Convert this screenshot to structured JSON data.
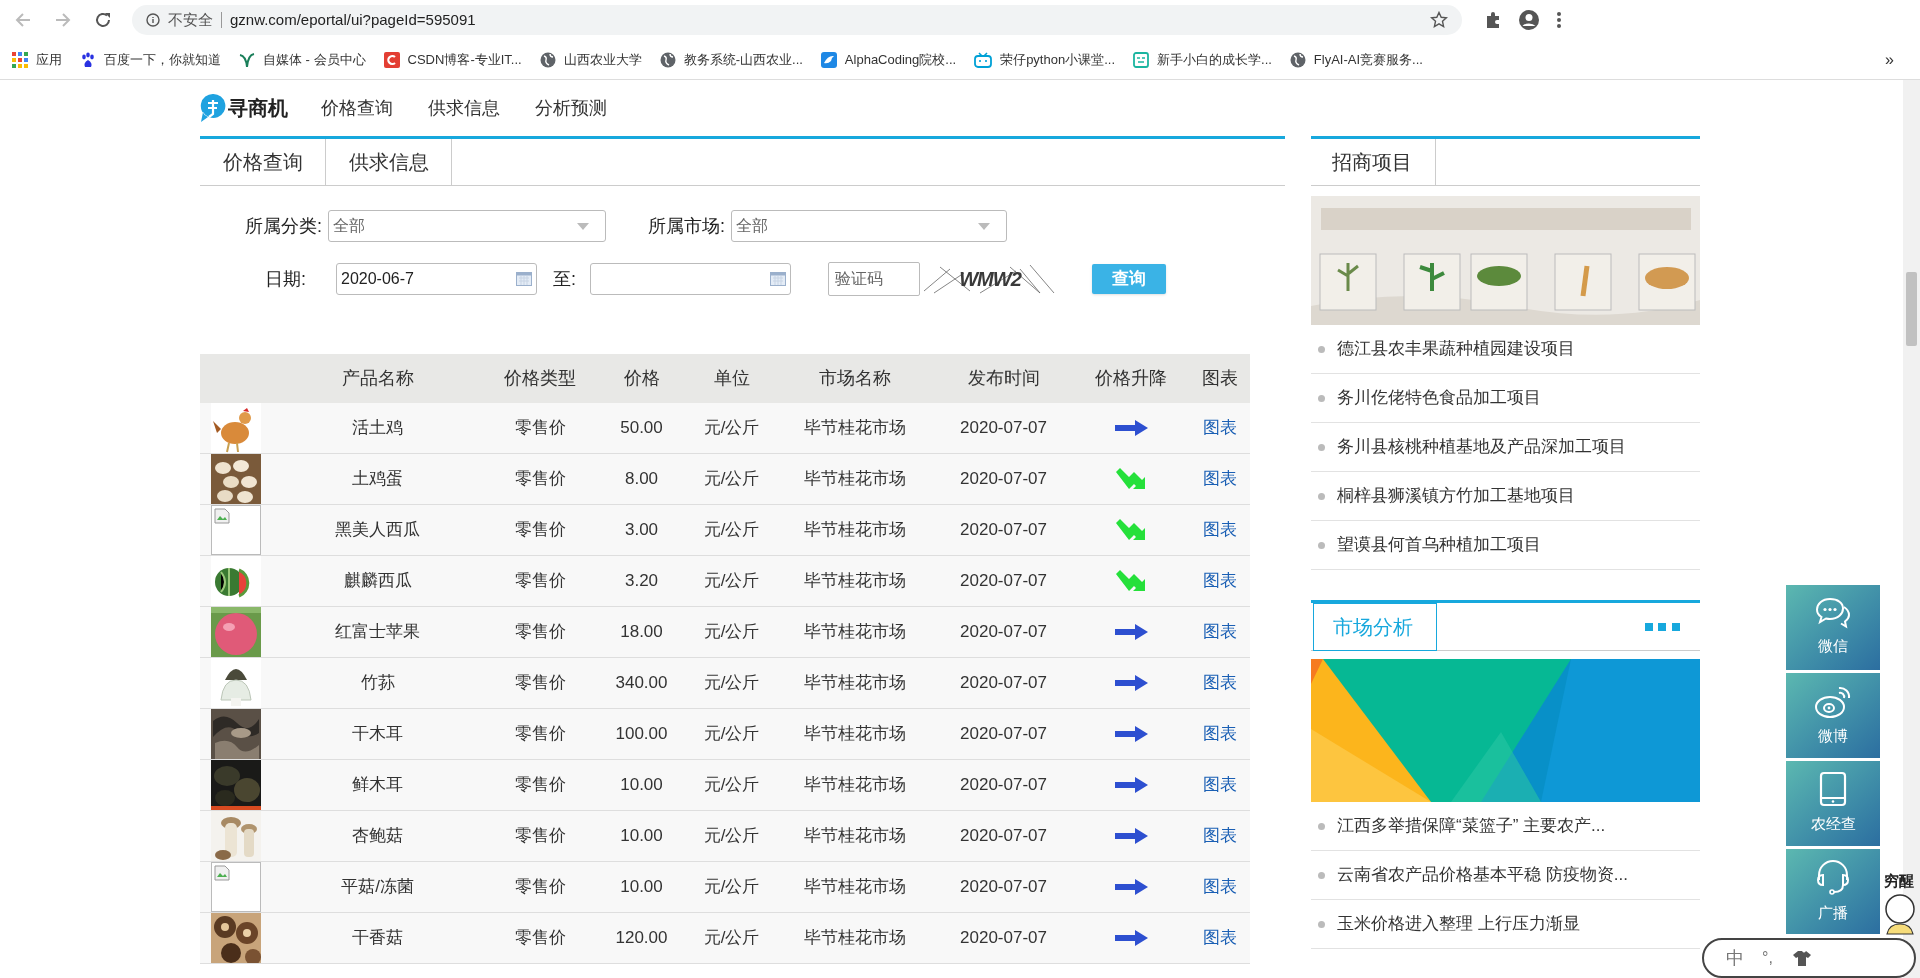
{
  "browser": {
    "security": "不安全",
    "url": "gznw.com/eportal/ui?pageId=595091",
    "bookmarks": [
      "应用",
      "百度一下，你就知道",
      "自媒体 - 会员中心",
      "CSDN博客-专业IT...",
      "山西农业大学",
      "教务系统-山西农业...",
      "AlphaCoding院校...",
      "荣仔python小课堂...",
      "新手小白的成长学...",
      "FlyAI-AI竞赛服务..."
    ],
    "more": "»"
  },
  "site": {
    "logo": "寻商机",
    "nav": [
      "价格查询",
      "供求信息",
      "分析预测"
    ]
  },
  "tabs": [
    "价格查询",
    "供求信息"
  ],
  "filters": {
    "category_label": "所属分类:",
    "category_value": "全部",
    "market_label": "所属市场:",
    "market_value": "全部",
    "date_label": "日期:",
    "date_from": "2020-06-7",
    "to_label": "至:",
    "captcha_placeholder": "验证码",
    "captcha_code": "WMW2",
    "submit": "查询"
  },
  "table": {
    "columns": [
      "产品名称",
      "价格类型",
      "价格",
      "单位",
      "市场名称",
      "发布时间",
      "价格升降",
      "图表"
    ],
    "rows": [
      {
        "name": "活土鸡",
        "price_type": "零售价",
        "price": "50.00",
        "unit": "元/公斤",
        "market": "毕节桂花市场",
        "date": "2020-07-07",
        "trend": {
          "kind": "flat"
        },
        "chart": "图表"
      },
      {
        "name": "土鸡蛋",
        "price_type": "零售价",
        "price": "8.00",
        "unit": "元/公斤",
        "market": "毕节桂花市场",
        "date": "2020-07-07",
        "trend": {
          "kind": "down"
        },
        "chart": "图表"
      },
      {
        "image": {
          "kind": "broken"
        },
        "name": "黑美人西瓜",
        "price_type": "零售价",
        "price": "3.00",
        "unit": "元/公斤",
        "market": "毕节桂花市场",
        "date": "2020-07-07",
        "trend": {
          "kind": "down"
        },
        "chart": "图表"
      },
      {
        "name": "麒麟西瓜",
        "price_type": "零售价",
        "price": "3.20",
        "unit": "元/公斤",
        "market": "毕节桂花市场",
        "date": "2020-07-07",
        "trend": {
          "kind": "down"
        },
        "chart": "图表"
      },
      {
        "name": "红富士苹果",
        "price_type": "零售价",
        "price": "18.00",
        "unit": "元/公斤",
        "market": "毕节桂花市场",
        "date": "2020-07-07",
        "trend": {
          "kind": "flat"
        },
        "chart": "图表"
      },
      {
        "name": "竹荪",
        "price_type": "零售价",
        "price": "340.00",
        "unit": "元/公斤",
        "market": "毕节桂花市场",
        "date": "2020-07-07",
        "trend": {
          "kind": "flat"
        },
        "chart": "图表"
      },
      {
        "name": "干木耳",
        "price_type": "零售价",
        "price": "100.00",
        "unit": "元/公斤",
        "market": "毕节桂花市场",
        "date": "2020-07-07",
        "trend": {
          "kind": "flat"
        },
        "chart": "图表"
      },
      {
        "name": "鲜木耳",
        "price_type": "零售价",
        "price": "10.00",
        "unit": "元/公斤",
        "market": "毕节桂花市场",
        "date": "2020-07-07",
        "trend": {
          "kind": "flat"
        },
        "chart": "图表"
      },
      {
        "name": "杏鲍菇",
        "price_type": "零售价",
        "price": "10.00",
        "unit": "元/公斤",
        "market": "毕节桂花市场",
        "date": "2020-07-07",
        "trend": {
          "kind": "flat"
        },
        "chart": "图表"
      },
      {
        "image": {
          "kind": "broken"
        },
        "name": "平菇/冻菌",
        "price_type": "零售价",
        "price": "10.00",
        "unit": "元/公斤",
        "market": "毕节桂花市场",
        "date": "2020-07-07",
        "trend": {
          "kind": "flat"
        },
        "chart": "图表"
      },
      {
        "name": "干香菇",
        "price_type": "零售价",
        "price": "120.00",
        "unit": "元/公斤",
        "market": "毕节桂花市场",
        "date": "2020-07-07",
        "trend": {
          "kind": "flat"
        },
        "chart": "图表"
      }
    ]
  },
  "investment": {
    "tab": "招商项目",
    "items": [
      "德江县农丰果蔬种植园建设项目",
      "务川仡佬特色食品加工项目",
      "务川县核桃种植基地及产品深加工项目",
      "桐梓县狮溪镇方竹加工基地项目",
      "望谟县何首乌种植加工项目"
    ]
  },
  "analysis": {
    "tab": "市场分析",
    "items": [
      "江西多举措保障“菜篮子” 主要农产...",
      "云南省农产品价格基本平稳 防疫物资...",
      "玉米价格进入整理 上行压力渐显"
    ]
  },
  "float_menu": [
    "微信",
    "微博",
    "农经查",
    "广播"
  ],
  "ime": {
    "mode": "中",
    "punct": "°,",
    "badge": "穷醒"
  }
}
